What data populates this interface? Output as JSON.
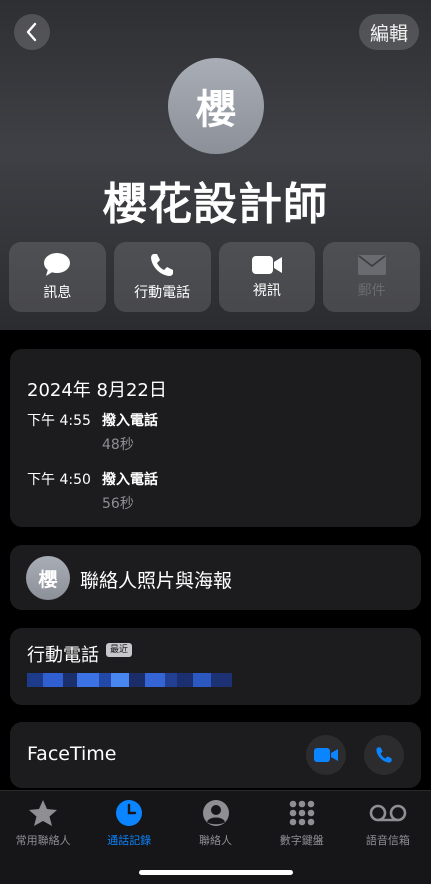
{
  "nav": {
    "edit_label": "編輯"
  },
  "contact": {
    "avatar_initial": "櫻",
    "name": "櫻花設計師"
  },
  "actions": [
    {
      "label": "訊息",
      "icon": "message-bubble-icon",
      "enabled": true
    },
    {
      "label": "行動電話",
      "icon": "phone-icon",
      "enabled": true
    },
    {
      "label": "視訊",
      "icon": "video-camera-icon",
      "enabled": true
    },
    {
      "label": "郵件",
      "icon": "envelope-icon",
      "enabled": false
    }
  ],
  "call_history": {
    "date": "2024年 8月22日",
    "entries": [
      {
        "time": "下午 4:55",
        "type": "撥入電話",
        "duration": "48秒"
      },
      {
        "time": "下午 4:50",
        "type": "撥入電話",
        "duration": "56秒"
      }
    ]
  },
  "poster": {
    "avatar_initial": "櫻",
    "label": "聯絡人照片與海報"
  },
  "phone": {
    "label": "行動電話",
    "badge": "最近"
  },
  "facetime": {
    "label": "FaceTime"
  },
  "tabbar": {
    "active": "通話記錄",
    "tabs": [
      {
        "label": "常用聯絡人",
        "icon": "star-icon"
      },
      {
        "label": "通話記錄",
        "icon": "clock-icon"
      },
      {
        "label": "聯絡人",
        "icon": "person-circle-icon"
      },
      {
        "label": "數字鍵盤",
        "icon": "keypad-icon"
      },
      {
        "label": "語音信箱",
        "icon": "voicemail-icon"
      }
    ]
  },
  "colors": {
    "accent": "#0a84ff",
    "card": "#1c1c1e",
    "background": "#000000"
  }
}
